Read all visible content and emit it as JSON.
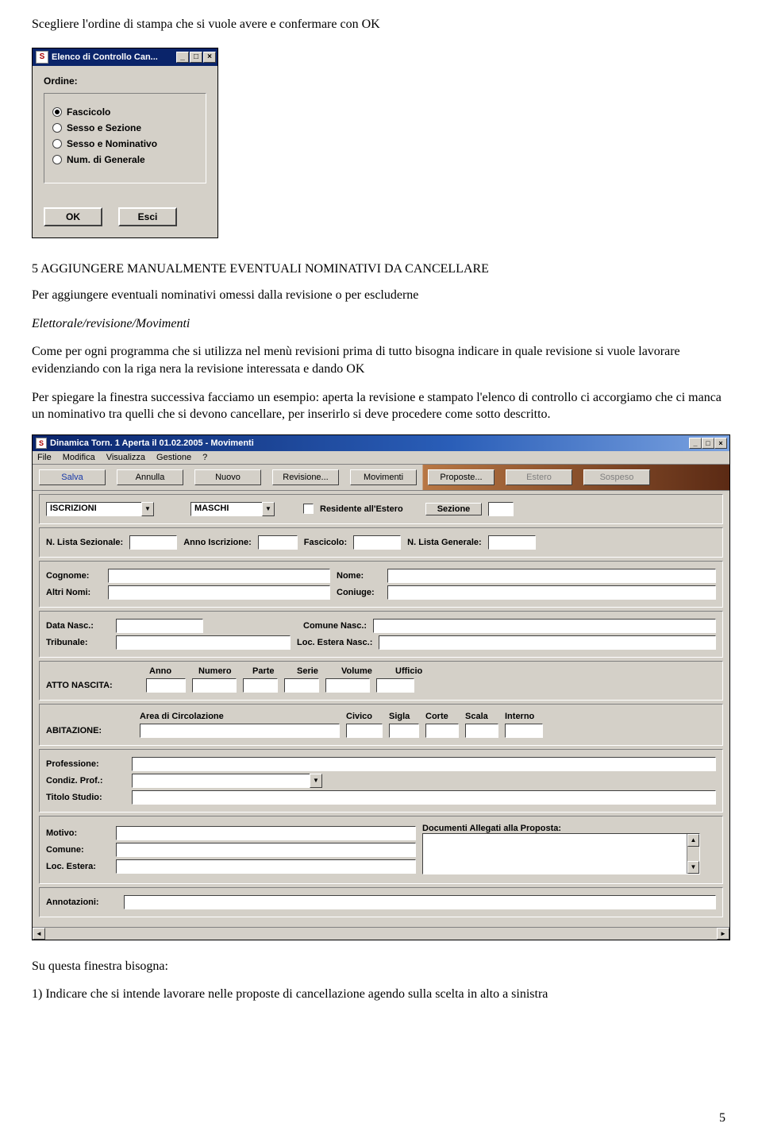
{
  "intro_text": "Scegliere l'ordine di stampa che si vuole avere e confermare con OK",
  "dialog1": {
    "title": "Elenco di Controllo Can...",
    "label_ordine": "Ordine:",
    "options": [
      "Fascicolo",
      "Sesso e Sezione",
      "Sesso e Nominativo",
      "Num. di Generale"
    ],
    "selected_index": 0,
    "ok": "OK",
    "esc": "Esci"
  },
  "section5": {
    "heading": "5    AGGIUNGERE MANUALMENTE EVENTUALI NOMINATIVI DA CANCELLARE",
    "p1": "Per aggiungere eventuali nominativi omessi dalla revisione o per escluderne",
    "path": "Elettorale/revisione/Movimenti",
    "p2": "Come per ogni programma che si utilizza nel menù revisioni prima di tutto bisogna indicare in quale revisione si vuole lavorare evidenziando con la riga nera la revisione interessata e dando OK",
    "p3": "Per spiegare la finestra successiva facciamo un esempio: aperta la revisione e stampato l'elenco di controllo ci accorgiamo che ci manca un nominativo tra quelli che si devono cancellare, per inserirlo si deve procedere come sotto descritto."
  },
  "win2": {
    "title": "Dinamica Torn. 1 Aperta il 01.02.2005 - Movimenti",
    "menu": [
      "File",
      "Modifica",
      "Visualizza",
      "Gestione",
      "?"
    ],
    "toolbar": {
      "salva": "Salva",
      "annulla": "Annulla",
      "nuovo": "Nuovo",
      "revisione": "Revisione...",
      "movimenti": "Movimenti",
      "proposte": "Proposte...",
      "estero": "Estero",
      "sospeso": "Sospeso"
    },
    "fields": {
      "iscrizioni": "ISCRIZIONI",
      "maschi": "MASCHI",
      "residente_estero": "Residente all'Estero",
      "sezione_btn": "Sezione",
      "n_lista_sez": "N. Lista Sezionale:",
      "anno_iscr": "Anno Iscrizione:",
      "fascicolo": "Fascicolo:",
      "n_lista_gen": "N. Lista Generale:",
      "cognome": "Cognome:",
      "nome": "Nome:",
      "altri_nomi": "Altri Nomi:",
      "coniuge": "Coniuge:",
      "data_nasc": "Data Nasc.:",
      "comune_nasc": "Comune Nasc.:",
      "tribunale": "Tribunale:",
      "loc_estera_nasc": "Loc. Estera Nasc.:",
      "atto_nascita": "ATTO NASCITA:",
      "col_anno": "Anno",
      "col_numero": "Numero",
      "col_parte": "Parte",
      "col_serie": "Serie",
      "col_volume": "Volume",
      "col_ufficio": "Ufficio",
      "abitazione": "ABITAZIONE:",
      "area_circ": "Area di Circolazione",
      "civico": "Civico",
      "sigla": "Sigla",
      "corte": "Corte",
      "scala": "Scala",
      "interno": "Interno",
      "professione": "Professione:",
      "condiz_prof": "Condiz. Prof.:",
      "titolo_studio": "Titolo Studio:",
      "motivo": "Motivo:",
      "comune": "Comune:",
      "loc_estera": "Loc. Estera:",
      "doc_allegati": "Documenti Allegati alla Proposta:",
      "annotazioni": "Annotazioni:"
    }
  },
  "closing": {
    "p1": "Su questa finestra bisogna:",
    "p2": "1) Indicare che si intende lavorare nelle proposte di cancellazione agendo sulla scelta in alto a sinistra"
  },
  "page_number": "5"
}
